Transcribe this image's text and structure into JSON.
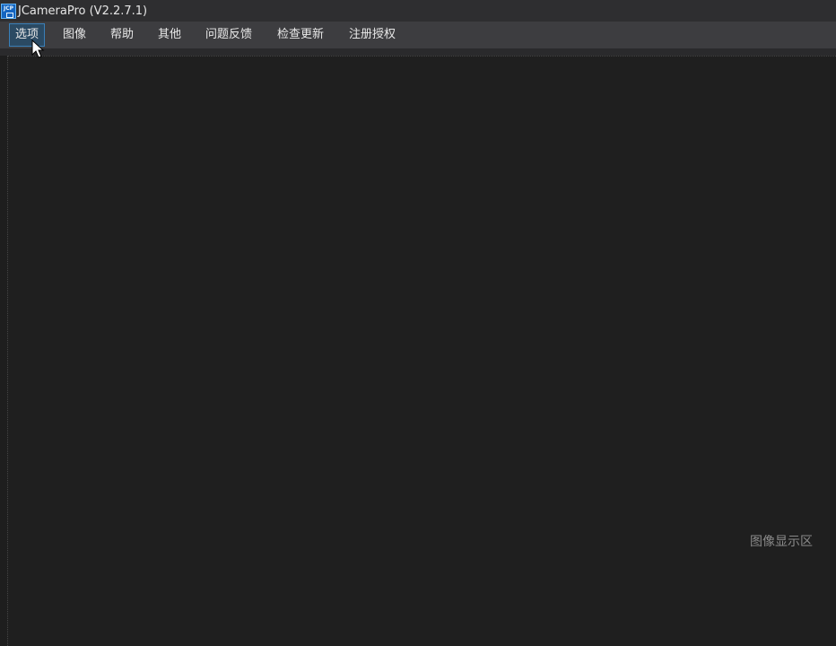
{
  "window": {
    "title": "JCameraPro (V2.2.7.1)",
    "icon_text": "JCP"
  },
  "menu": {
    "items": [
      {
        "label": "选项",
        "active": true
      },
      {
        "label": "图像"
      },
      {
        "label": "帮助"
      },
      {
        "label": "其他"
      },
      {
        "label": "问题反馈"
      },
      {
        "label": "检查更新"
      },
      {
        "label": "注册授权"
      }
    ]
  },
  "display": {
    "placeholder": "图像显示区"
  },
  "colors": {
    "titlebar_bg": "#2e2e30",
    "menubar_bg": "#3d3d40",
    "menu_active_bg": "#2b4a63",
    "menu_active_border": "#3a7fb8",
    "display_bg": "#1f1f1f",
    "placeholder_text": "#8a8a8a"
  }
}
